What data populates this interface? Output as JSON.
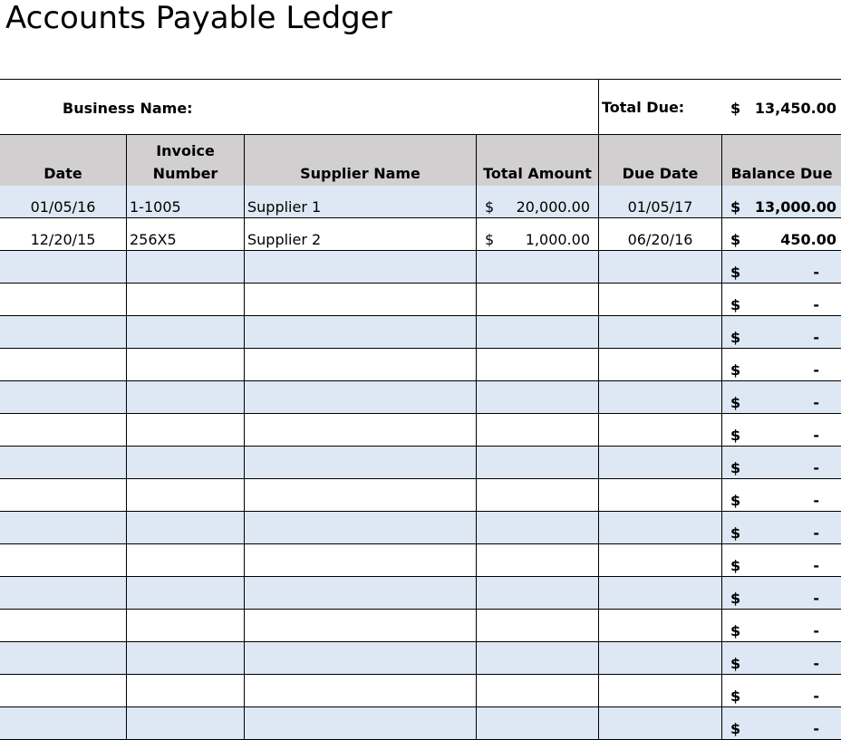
{
  "title": "Accounts Payable Ledger",
  "business": {
    "label": "Business Name:",
    "value": ""
  },
  "total_due": {
    "label": "Total Due:",
    "currency": "$",
    "amount": "13,450.00"
  },
  "columns": [
    "Date",
    "Invoice\nNumber",
    "Supplier Name",
    "Total Amount",
    "Due Date",
    "Balance Due"
  ],
  "colors": {
    "header_bg": "#d1cfcf",
    "band_bg": "#dde8f4"
  },
  "currency_symbol": "$",
  "empty_balance": "-",
  "rows": [
    {
      "date": "01/05/16",
      "invoice": "1-1005",
      "supplier": "Supplier 1",
      "total": "20,000.00",
      "due": "01/05/17",
      "balance": "13,000.00"
    },
    {
      "date": "12/20/15",
      "invoice": "256X5",
      "supplier": "Supplier 2",
      "total": "1,000.00",
      "due": "06/20/16",
      "balance": "450.00"
    },
    {
      "date": "",
      "invoice": "",
      "supplier": "",
      "total": "",
      "due": "",
      "balance": ""
    },
    {
      "date": "",
      "invoice": "",
      "supplier": "",
      "total": "",
      "due": "",
      "balance": ""
    },
    {
      "date": "",
      "invoice": "",
      "supplier": "",
      "total": "",
      "due": "",
      "balance": ""
    },
    {
      "date": "",
      "invoice": "",
      "supplier": "",
      "total": "",
      "due": "",
      "balance": ""
    },
    {
      "date": "",
      "invoice": "",
      "supplier": "",
      "total": "",
      "due": "",
      "balance": ""
    },
    {
      "date": "",
      "invoice": "",
      "supplier": "",
      "total": "",
      "due": "",
      "balance": ""
    },
    {
      "date": "",
      "invoice": "",
      "supplier": "",
      "total": "",
      "due": "",
      "balance": ""
    },
    {
      "date": "",
      "invoice": "",
      "supplier": "",
      "total": "",
      "due": "",
      "balance": ""
    },
    {
      "date": "",
      "invoice": "",
      "supplier": "",
      "total": "",
      "due": "",
      "balance": ""
    },
    {
      "date": "",
      "invoice": "",
      "supplier": "",
      "total": "",
      "due": "",
      "balance": ""
    },
    {
      "date": "",
      "invoice": "",
      "supplier": "",
      "total": "",
      "due": "",
      "balance": ""
    },
    {
      "date": "",
      "invoice": "",
      "supplier": "",
      "total": "",
      "due": "",
      "balance": ""
    },
    {
      "date": "",
      "invoice": "",
      "supplier": "",
      "total": "",
      "due": "",
      "balance": ""
    },
    {
      "date": "",
      "invoice": "",
      "supplier": "",
      "total": "",
      "due": "",
      "balance": ""
    },
    {
      "date": "",
      "invoice": "",
      "supplier": "",
      "total": "",
      "due": "",
      "balance": ""
    }
  ]
}
